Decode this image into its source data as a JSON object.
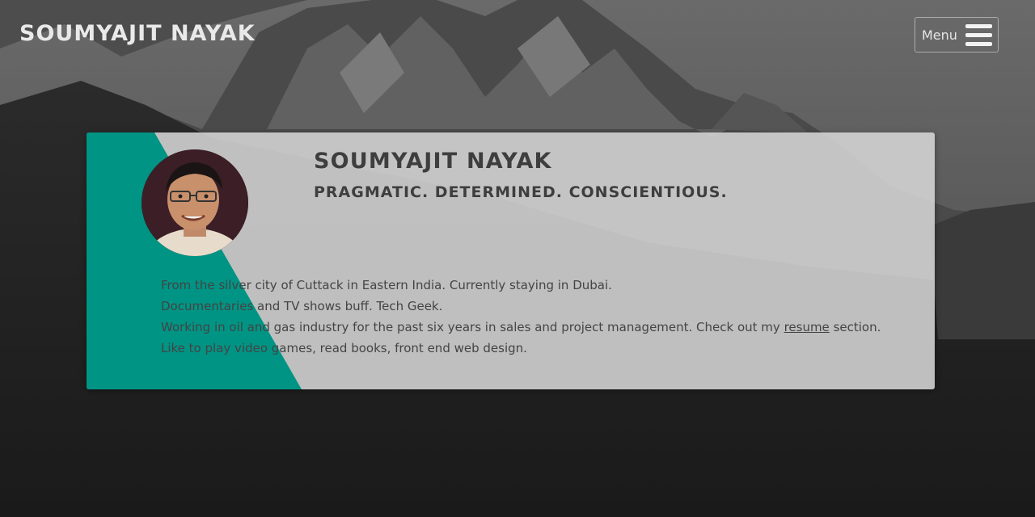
{
  "header": {
    "brand": "SOUMYAJIT NAYAK",
    "menu_label": "Menu"
  },
  "profile": {
    "name": "SOUMYAJIT NAYAK",
    "tagline": "PRAGMATIC. DETERMINED. CONSCIENTIOUS.",
    "bio": {
      "line1": "From the silver city of Cuttack in Eastern India. Currently staying in Dubai.",
      "line2": "Documentaries and TV shows buff. Tech Geek.",
      "line3_before": "Working in oil and gas industry for the past six years in sales and project management. Check out my ",
      "line3_link": "resume",
      "line3_after": " section.",
      "line4": "Like to play video games, read books, front end web design."
    }
  },
  "colors": {
    "accent": "#009484",
    "card": "#d7d7d7",
    "text": "#3e3e3e"
  },
  "icons": {
    "menu": "hamburger-icon"
  }
}
